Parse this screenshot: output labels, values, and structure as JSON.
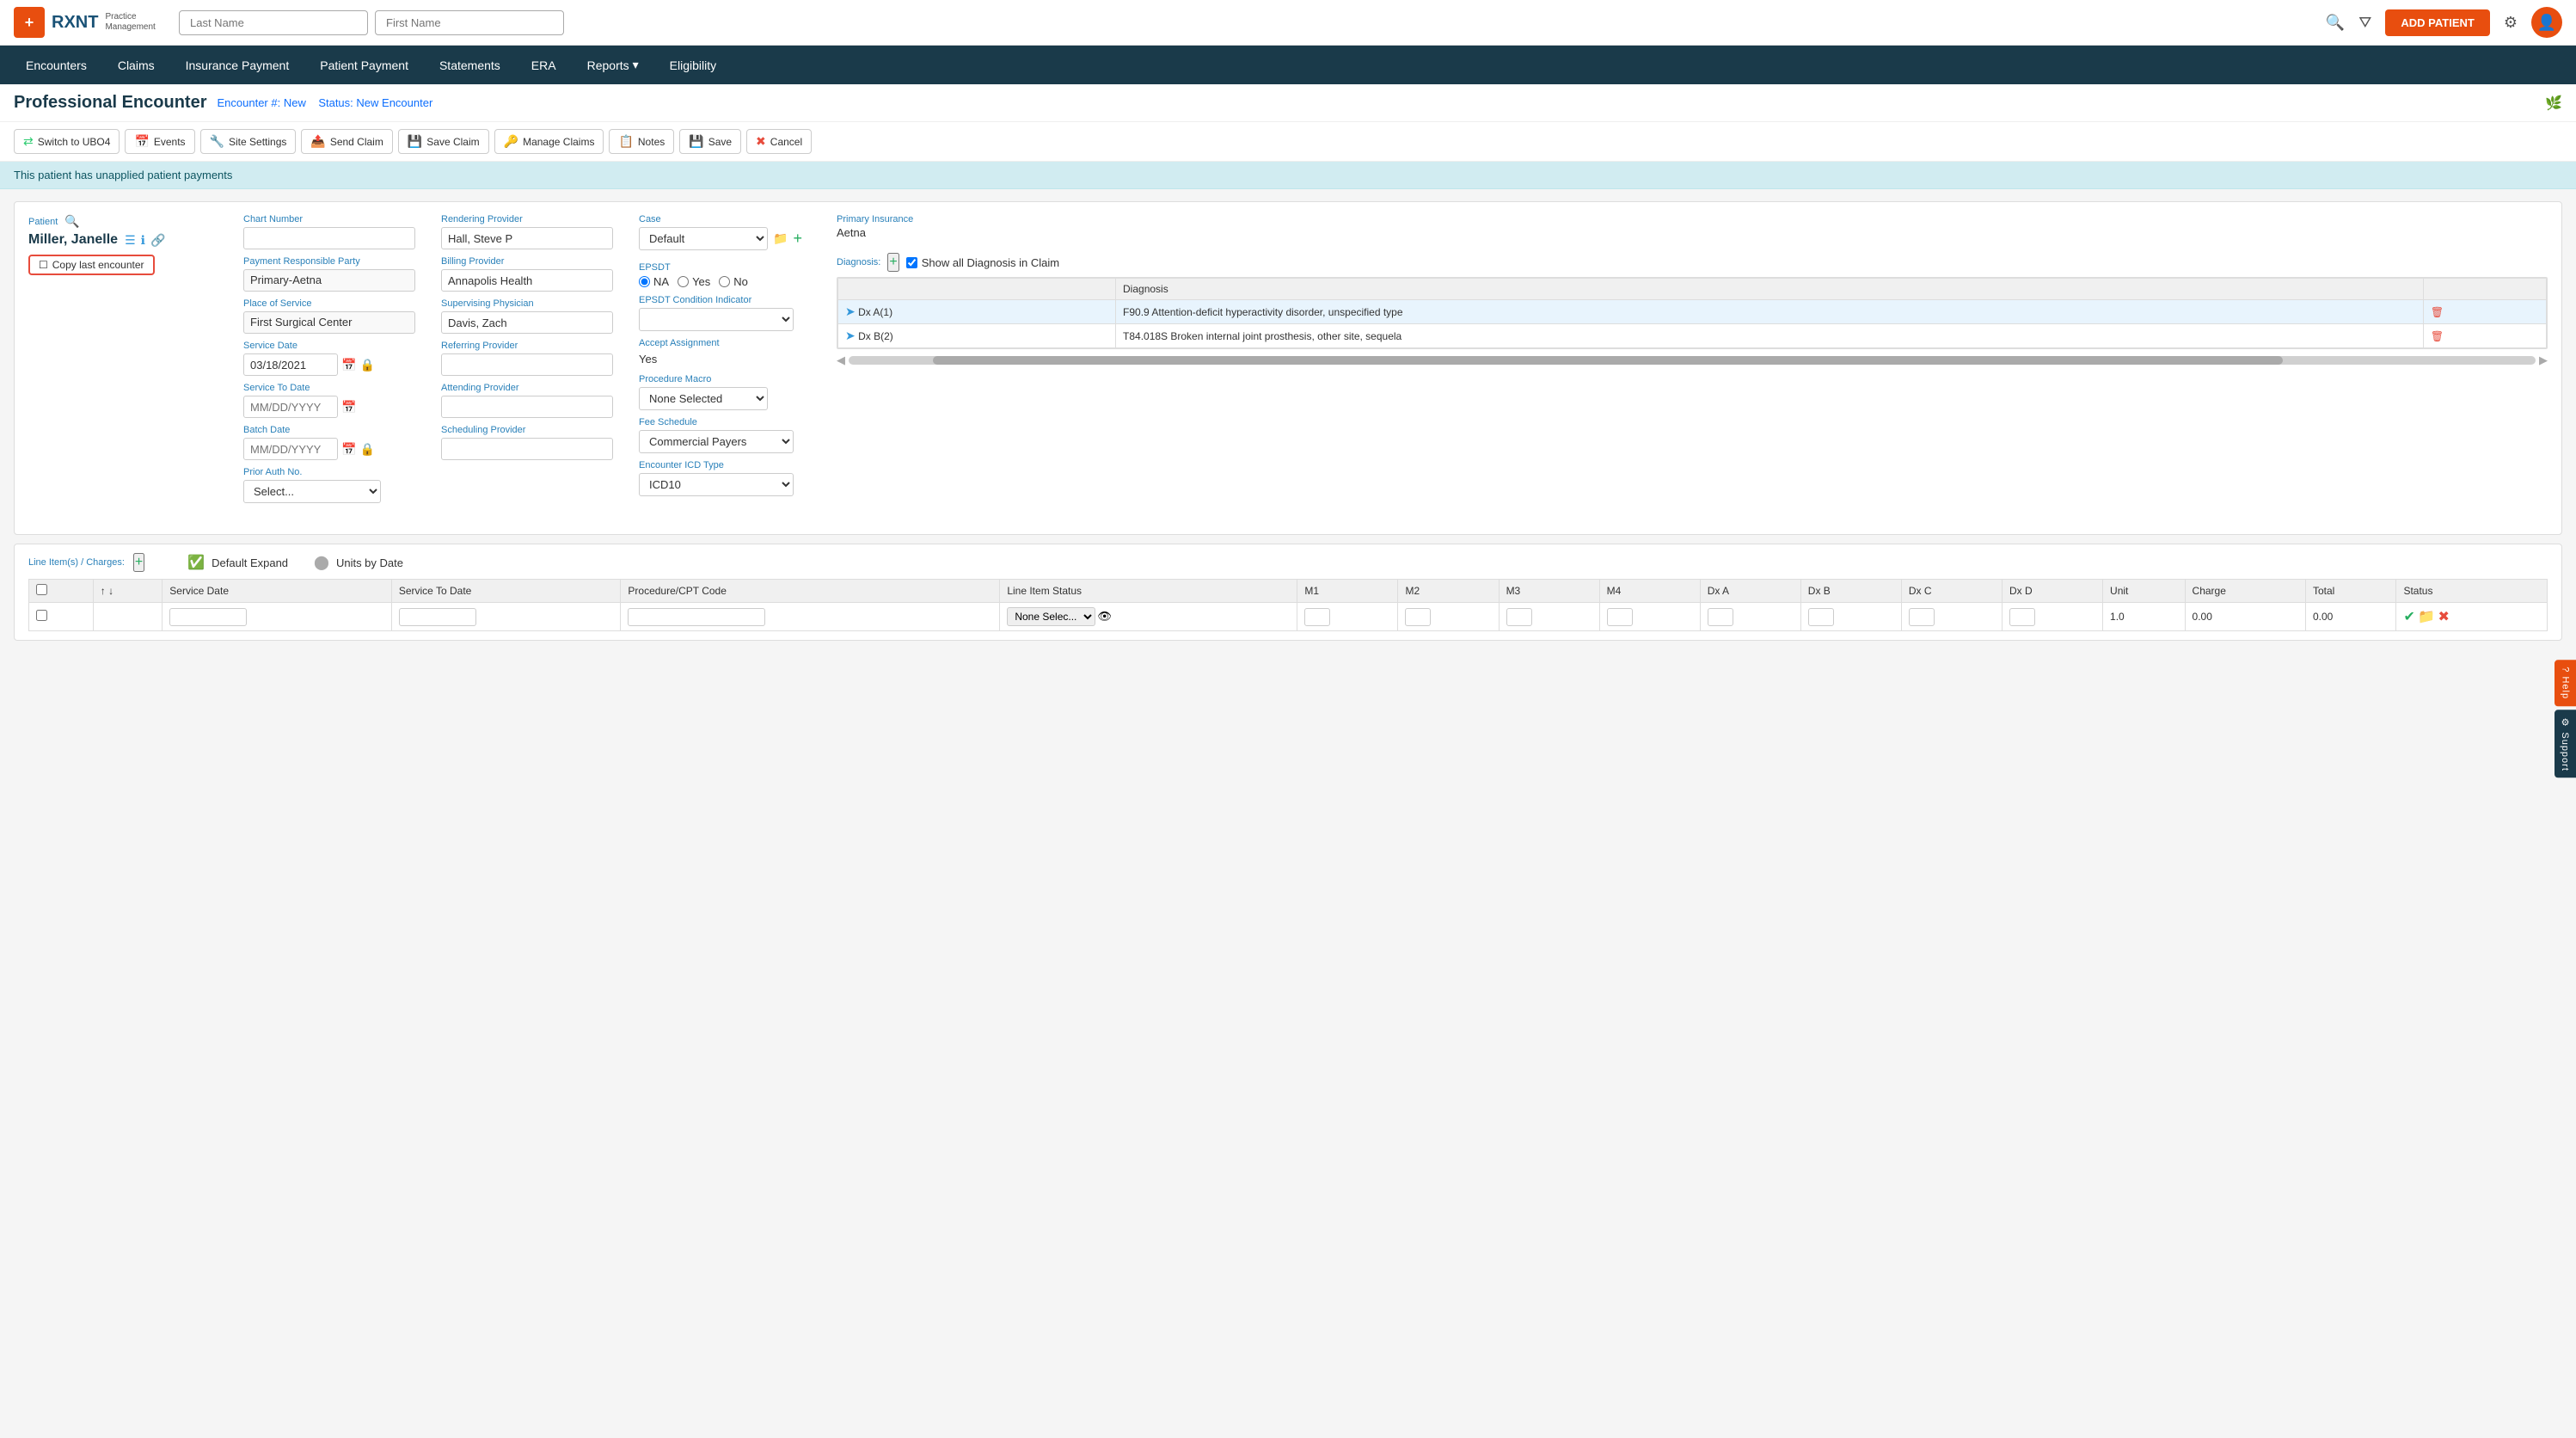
{
  "app": {
    "logo_text": "RXNT",
    "logo_subtitle_line1": "Practice",
    "logo_subtitle_line2": "Management"
  },
  "header": {
    "last_name_placeholder": "Last Name",
    "first_name_placeholder": "First Name",
    "add_patient_label": "ADD PATIENT"
  },
  "nav": {
    "items": [
      {
        "label": "Encounters",
        "active": true
      },
      {
        "label": "Claims"
      },
      {
        "label": "Insurance Payment"
      },
      {
        "label": "Patient Payment"
      },
      {
        "label": "Statements"
      },
      {
        "label": "ERA"
      },
      {
        "label": "Reports"
      },
      {
        "label": "Eligibility"
      }
    ]
  },
  "page": {
    "title": "Professional Encounter",
    "encounter_label": "Encounter #:",
    "encounter_number": "New",
    "status_label": "Status:",
    "status_value": "New Encounter"
  },
  "toolbar": {
    "switch_label": "Switch to UBO4",
    "events_label": "Events",
    "site_settings_label": "Site Settings",
    "send_claim_label": "Send Claim",
    "save_claim_label": "Save Claim",
    "manage_claims_label": "Manage Claims",
    "notes_label": "Notes",
    "save_label": "Save",
    "cancel_label": "Cancel"
  },
  "alert": {
    "message": "This patient has unapplied patient payments"
  },
  "patient": {
    "label": "Patient",
    "name": "Miller, Janelle",
    "copy_button": "Copy last encounter"
  },
  "case_section": {
    "label": "Case",
    "value": "Default",
    "options": [
      "Default"
    ]
  },
  "primary_insurance": {
    "label": "Primary Insurance",
    "value": "Aetna"
  },
  "fields": {
    "chart_number": {
      "label": "Chart Number",
      "value": ""
    },
    "payment_responsible": {
      "label": "Payment Responsible Party",
      "value": "Primary-Aetna"
    },
    "place_of_service": {
      "label": "Place of Service",
      "value": "First Surgical Center"
    },
    "service_date": {
      "label": "Service Date",
      "value": "03/18/2021",
      "placeholder": "MM/DD/YYYY"
    },
    "service_to_date": {
      "label": "Service To Date",
      "value": "",
      "placeholder": "MM/DD/YYYY"
    },
    "batch_date": {
      "label": "Batch Date",
      "value": "",
      "placeholder": "MM/DD/YYYY"
    },
    "prior_auth": {
      "label": "Prior Auth No.",
      "value": "Select..."
    },
    "rendering_provider": {
      "label": "Rendering Provider",
      "value": "Hall, Steve P"
    },
    "billing_provider": {
      "label": "Billing Provider",
      "value": "Annapolis Health"
    },
    "supervising_physician": {
      "label": "Supervising Physician",
      "value": "Davis, Zach"
    },
    "referring_provider": {
      "label": "Referring Provider",
      "value": ""
    },
    "attending_provider": {
      "label": "Attending Provider",
      "value": ""
    },
    "scheduling_provider": {
      "label": "Scheduling Provider",
      "value": ""
    },
    "epsdt": {
      "label": "EPSDT",
      "options": [
        "NA",
        "Yes",
        "No"
      ],
      "selected": "NA"
    },
    "epsdt_condition": {
      "label": "EPSDT Condition Indicator",
      "value": ""
    },
    "accept_assignment": {
      "label": "Accept Assignment",
      "value": "Yes"
    },
    "procedure_macro": {
      "label": "Procedure Macro",
      "value": "None Selected"
    },
    "fee_schedule": {
      "label": "Fee Schedule",
      "value": "Commercial Payers"
    },
    "encounter_icd": {
      "label": "Encounter ICD Type",
      "value": "ICD10"
    }
  },
  "diagnosis": {
    "label": "Diagnosis:",
    "show_all_label": "Show all Diagnosis in Claim",
    "columns": [
      "",
      "Diagnosis"
    ],
    "rows": [
      {
        "dx": "Dx A(1)",
        "code": "F90.9 Attention-deficit hyperactivity disorder, unspecified type"
      },
      {
        "dx": "Dx B(2)",
        "code": "T84.018S Broken internal joint prosthesis, other site, sequela"
      }
    ]
  },
  "line_items": {
    "label": "Line Item(s) / Charges:",
    "default_expand_label": "Default Expand",
    "units_by_date_label": "Units by Date",
    "columns": [
      "",
      "",
      "Service Date",
      "Service To Date",
      "Procedure/CPT Code",
      "Line Item Status",
      "M1",
      "M2",
      "M3",
      "M4",
      "Dx A",
      "Dx B",
      "Dx C",
      "Dx D",
      "Unit",
      "Charge",
      "Total",
      "Status"
    ],
    "rows": [
      {
        "service_date": "",
        "service_to_date": "",
        "procedure_cpt": "",
        "line_item_status": "None Selec...",
        "m1": "",
        "m2": "",
        "m3": "",
        "m4": "",
        "dx_a": "",
        "dx_b": "",
        "dx_c": "",
        "dx_d": "",
        "unit": "1.0",
        "charge": "0.00",
        "total": "0.00",
        "status": ""
      }
    ]
  },
  "side_buttons": {
    "help_label": "? Help",
    "support_label": "⚙ Support"
  }
}
